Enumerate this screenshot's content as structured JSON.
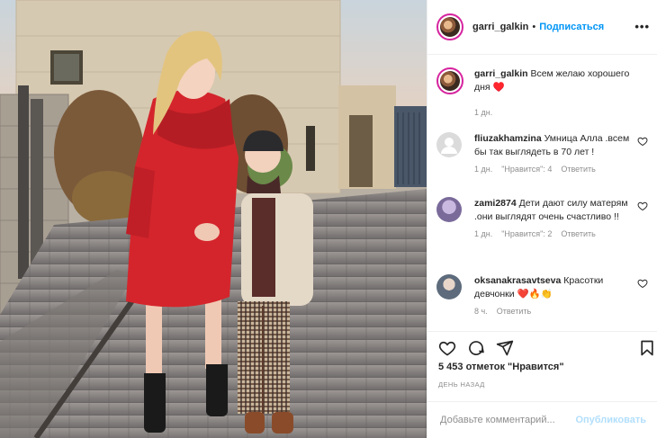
{
  "post": {
    "username": "garri_galkin",
    "follow_label": "Подписаться",
    "more_icon": "more-horizontal-icon",
    "caption_text": "Всем желаю хорошего дня ♥️",
    "caption_time": "1 дн."
  },
  "comments": [
    {
      "username": "fliuzakhamzina",
      "text": "Умница Алла .всем бы так выглядеть в 70 лет !",
      "time": "1 дн.",
      "likes": "\"Нравится\": 4",
      "reply": "Ответить"
    },
    {
      "username": "zami2874",
      "text": "Дети дают силу матерям .они выглядят очень счастливо !!",
      "time": "1 дн.",
      "likes": "\"Нравится\": 2",
      "reply": "Ответить"
    },
    {
      "username": "oksanakrasavtseva",
      "text": "Красотки девчонки ❤️🔥👏",
      "time": "8 ч.",
      "reply": "Ответить"
    }
  ],
  "actions": {
    "like_icon": "heart-icon",
    "comment_icon": "comment-icon",
    "share_icon": "share-icon",
    "save_icon": "bookmark-icon"
  },
  "likes_text": "5 453 отметок \"Нравится\"",
  "date_text": "ДЕНЬ НАЗАД",
  "add_comment": {
    "placeholder": "Добавьте комментарий...",
    "publish_label": "Опубликовать"
  },
  "colors": {
    "link": "#0095f6",
    "publish_disabled": "#b2dffc",
    "coat": "#d4252c",
    "border": "#efefef"
  }
}
